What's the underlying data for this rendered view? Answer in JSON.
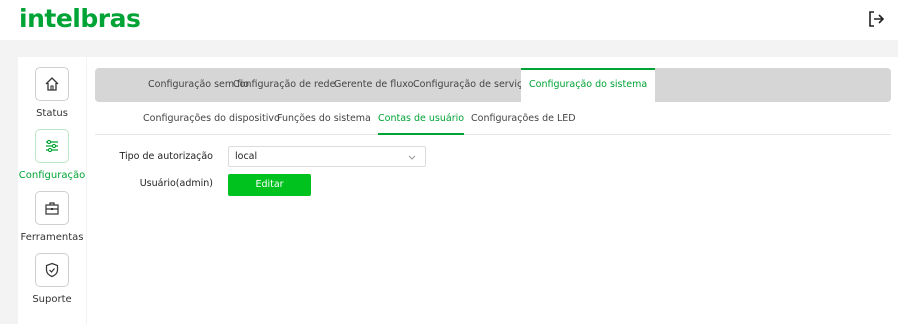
{
  "header": {
    "logo_text": "intelbras"
  },
  "sidebar": {
    "items": [
      {
        "label": "Status",
        "icon": "home-icon"
      },
      {
        "label": "Configuração",
        "icon": "sliders-icon"
      },
      {
        "label": "Ferramentas",
        "icon": "toolbox-icon"
      },
      {
        "label": "Suporte",
        "icon": "shield-check-icon"
      }
    ],
    "active": "Configuração"
  },
  "tabs": [
    {
      "label": "Configuração sem fio"
    },
    {
      "label": "Configuração de rede"
    },
    {
      "label": "Gerente de fluxo"
    },
    {
      "label": "Configuração de serviços"
    },
    {
      "label": "Configuração do sistema"
    }
  ],
  "active_tab": "Configuração do sistema",
  "subtabs": [
    {
      "label": "Configurações do dispositivo"
    },
    {
      "label": "Funções do sistema"
    },
    {
      "label": "Contas de usuário"
    },
    {
      "label": "Configurações de LED"
    }
  ],
  "active_subtab": "Contas de usuário",
  "form": {
    "auth_type_label": "Tipo de autorização",
    "auth_type_value": "local",
    "user_label": "Usuário(admin)",
    "edit_button": "Editar"
  },
  "colors": {
    "accent": "#00a335",
    "button": "#00c21f",
    "tabbar": "#d6d6d6"
  }
}
